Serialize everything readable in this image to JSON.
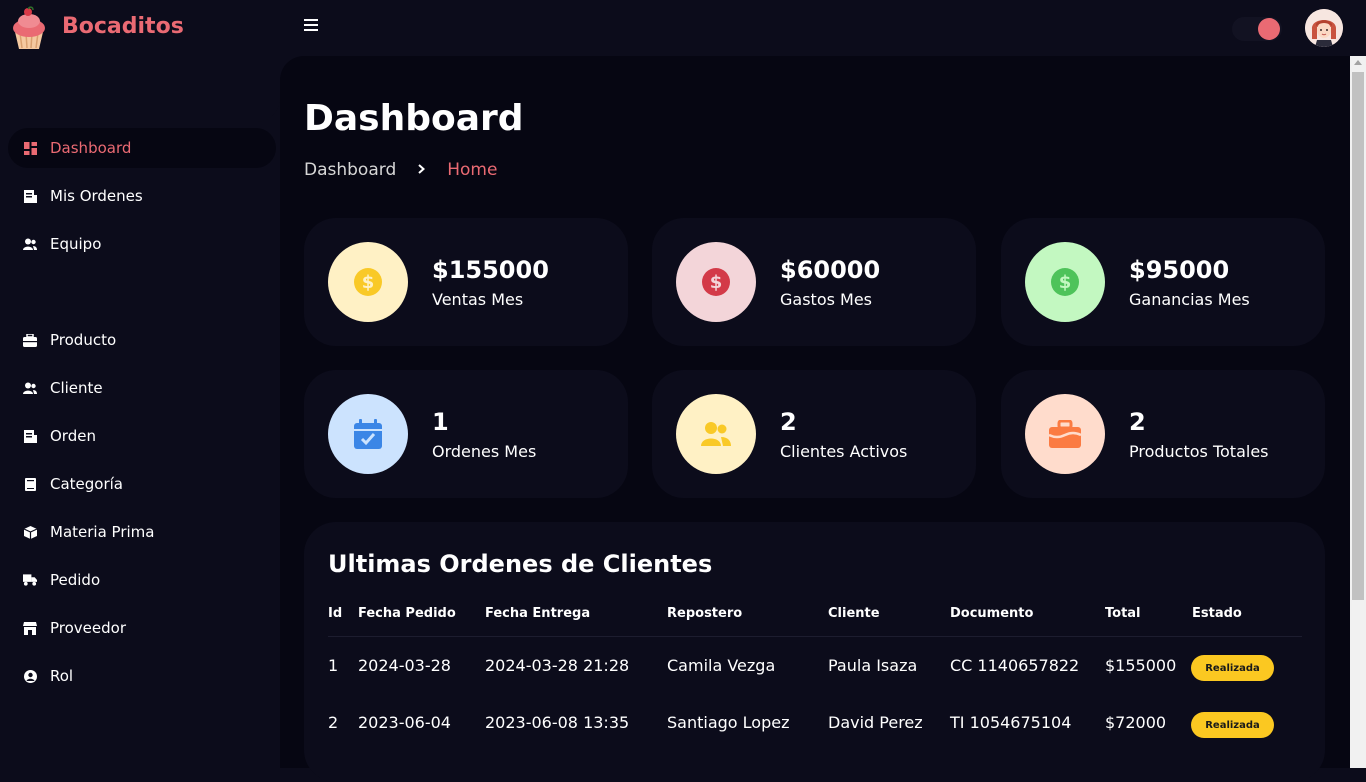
{
  "app": {
    "brand": "Bocaditos"
  },
  "colors": {
    "accent": "#ea6a73",
    "badge": "#fbc821"
  },
  "sidebar": {
    "items": [
      {
        "label": "Dashboard",
        "icon": "grid-icon",
        "active": true
      },
      {
        "label": "Mis Ordenes",
        "icon": "receipt-icon"
      },
      {
        "label": "Equipo",
        "icon": "users-icon"
      },
      {
        "label": "Producto",
        "icon": "briefcase-icon"
      },
      {
        "label": "Cliente",
        "icon": "user-icon"
      },
      {
        "label": "Orden",
        "icon": "receipt-icon"
      },
      {
        "label": "Categoría",
        "icon": "book-icon"
      },
      {
        "label": "Materia Prima",
        "icon": "box-icon"
      },
      {
        "label": "Pedido",
        "icon": "truck-icon"
      },
      {
        "label": "Proveedor",
        "icon": "store-icon"
      },
      {
        "label": "Rol",
        "icon": "user-circle-icon"
      }
    ]
  },
  "page": {
    "title": "Dashboard",
    "breadcrumb": [
      "Dashboard",
      "Home"
    ]
  },
  "cards": [
    {
      "value": "$155000",
      "label": "Ventas Mes",
      "icon": "dollar-icon"
    },
    {
      "value": "$60000",
      "label": "Gastos Mes",
      "icon": "dollar-icon"
    },
    {
      "value": "$95000",
      "label": "Ganancias Mes",
      "icon": "dollar-icon"
    },
    {
      "value": "1",
      "label": "Ordenes Mes",
      "icon": "calendar-check-icon"
    },
    {
      "value": "2",
      "label": "Clientes Activos",
      "icon": "users-icon"
    },
    {
      "value": "2",
      "label": "Productos Totales",
      "icon": "briefcase-icon"
    }
  ],
  "orders": {
    "title": "Ultimas Ordenes de Clientes",
    "columns": [
      "Id",
      "Fecha Pedido",
      "Fecha Entrega",
      "Repostero",
      "Cliente",
      "Documento",
      "Total",
      "Estado"
    ],
    "rows": [
      [
        "1",
        "2024-03-28",
        "2024-03-28 21:28",
        "Camila Vezga",
        "Paula Isaza",
        "CC 1140657822",
        "$155000",
        "Realizada"
      ],
      [
        "2",
        "2023-06-04",
        "2023-06-08 13:35",
        "Santiago Lopez",
        "David Perez",
        "TI 1054675104",
        "$72000",
        "Realizada"
      ]
    ]
  }
}
